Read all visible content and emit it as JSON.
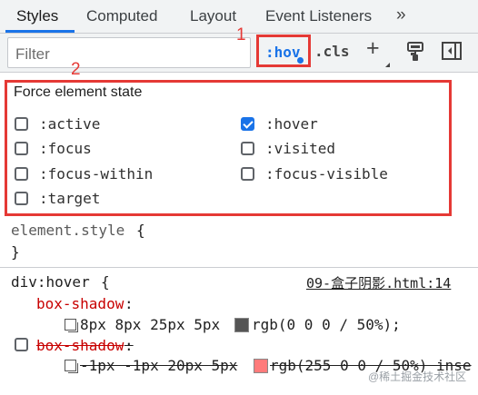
{
  "tabs": [
    {
      "label": "Styles",
      "active": true
    },
    {
      "label": "Computed",
      "active": false
    },
    {
      "label": "Layout",
      "active": false
    },
    {
      "label": "Event Listeners",
      "active": false
    }
  ],
  "tab_overflow": "»",
  "toolbar": {
    "filter_placeholder": "Filter",
    "hov_label": ":hov",
    "cls_label": ".cls",
    "plus_label": "+",
    "paint_icon": "paint-brush-icon",
    "sidebar_icon": "toggle-sidebar-icon"
  },
  "annotations": [
    {
      "number": "1",
      "target": "hov-button"
    },
    {
      "number": "2",
      "target": "force-state-panel"
    }
  ],
  "force_state": {
    "title": "Force element state",
    "items": [
      {
        "label": ":active",
        "checked": false
      },
      {
        "label": ":hover",
        "checked": true
      },
      {
        "label": ":focus",
        "checked": false
      },
      {
        "label": ":visited",
        "checked": false
      },
      {
        "label": ":focus-within",
        "checked": false
      },
      {
        "label": ":focus-visible",
        "checked": false
      },
      {
        "label": ":target",
        "checked": false
      }
    ]
  },
  "element_style": {
    "selector": "element.style",
    "open_brace": "{",
    "close_brace": "}"
  },
  "rule": {
    "selector": "div:hover",
    "open_brace": "{",
    "source": "09-盒子阴影.html:14",
    "declarations": [
      {
        "property": "box-shadow",
        "colon": ":",
        "value_pre": "8px 8px 25px 5px",
        "swatch_color": "#555555",
        "value_post": "rgb(0 0 0 / 50%);",
        "overridden": false,
        "enabled": true
      },
      {
        "property": "box-shadow",
        "colon": ":",
        "value_pre": "-1px -1px 20px 5px",
        "swatch_color": "#ff7b7b",
        "value_post": "rgb(255 0 0 / 50%) inse",
        "overridden": true,
        "enabled": false
      }
    ]
  },
  "watermark": "@稀土掘金技术社区",
  "colors": {
    "accent": "#1a73e8",
    "annotation": "#e53935",
    "property": "#c80000"
  }
}
